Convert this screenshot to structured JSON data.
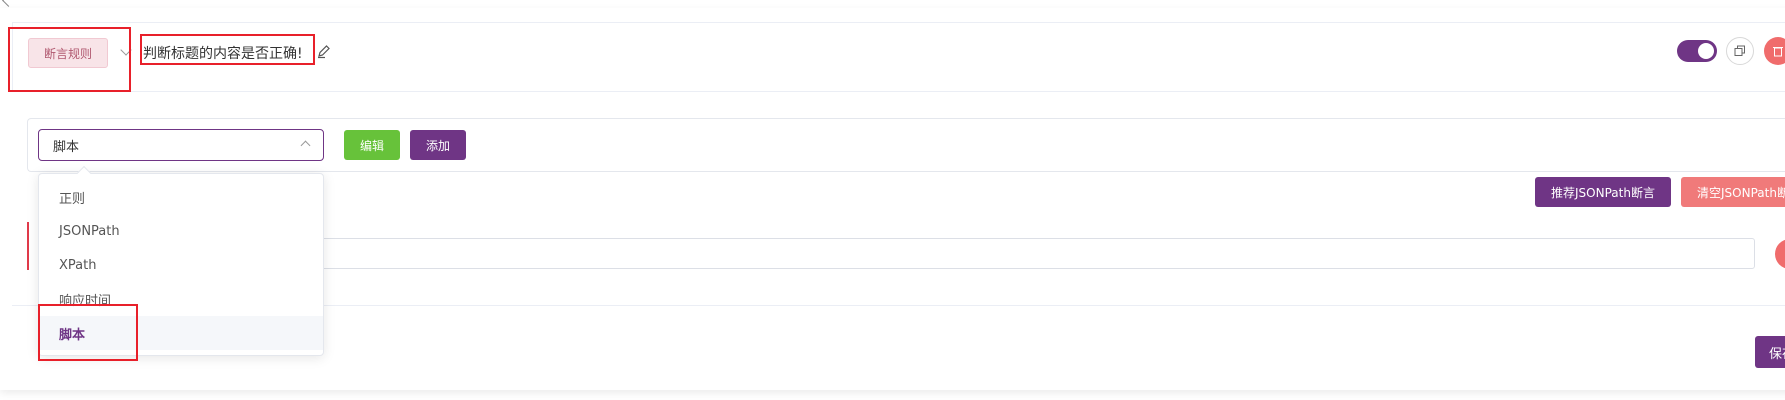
{
  "header": {
    "rule_type_tag": "断言规则",
    "title": "判断标题的内容是否正确!",
    "enabled": true
  },
  "extractor": {
    "selected": "脚本",
    "edit_label": "编辑",
    "add_label": "添加",
    "options": [
      "正则",
      "JSONPath",
      "XPath",
      "响应时间",
      "脚本"
    ]
  },
  "assertion_actions": {
    "recommend_label": "推荐JSONPath断言",
    "clear_label": "清空JSONPath断"
  },
  "footer": {
    "save_label": "保存"
  },
  "icons": {
    "edit": "pencil-icon",
    "copy": "copy-icon",
    "delete": "trash-icon",
    "chevron": "chevron-icon"
  },
  "colors": {
    "primary": "#6f3585",
    "success": "#67c23a",
    "danger": "#f06c6c",
    "annotation": "#e8202a"
  }
}
